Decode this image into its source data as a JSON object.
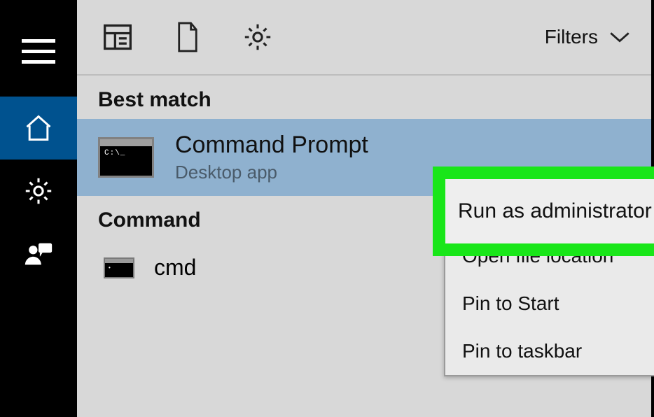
{
  "sidebar": {
    "items": [
      "menu",
      "home",
      "settings",
      "people"
    ]
  },
  "toprow": {
    "filters_label": "Filters"
  },
  "sections": {
    "best_match_label": "Best match",
    "command_label": "Command"
  },
  "best_match": {
    "title": "Command Prompt",
    "subtitle": "Desktop app"
  },
  "command_result": {
    "label": "cmd"
  },
  "context_menu": {
    "items": [
      "Run as administrator",
      "Open file location",
      "Pin to Start",
      "Pin to taskbar"
    ]
  },
  "highlight": {
    "text": "Run as administrator",
    "color": "#19e619"
  }
}
